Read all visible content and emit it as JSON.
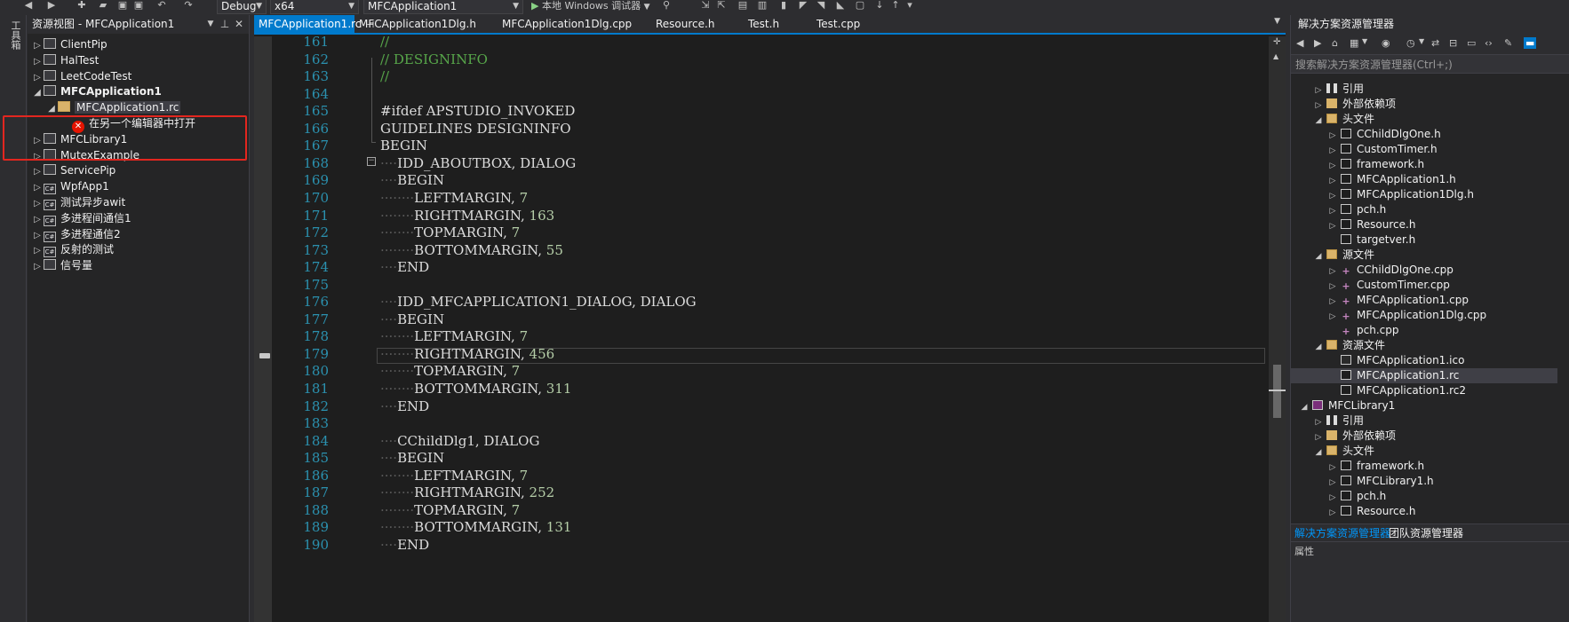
{
  "toolbar": {
    "config_combo": "Debug",
    "platform_combo": "x64",
    "startup_combo": "MFCApplication1",
    "run_label": "本地 Windows 调试器"
  },
  "left_strip": {
    "label": "工具箱"
  },
  "resource_view": {
    "title": "资源视图 - MFCApplication1",
    "items": [
      {
        "label": "ClientPip",
        "icon": "resource-icon",
        "expander": "▷"
      },
      {
        "label": "HalTest",
        "icon": "resource-icon",
        "expander": "▷"
      },
      {
        "label": "LeetCodeTest",
        "icon": "resource-icon",
        "expander": "▷"
      },
      {
        "label": "MFCApplication1",
        "icon": "resource-icon",
        "expander": "◢",
        "bold": true
      },
      {
        "label": "MFCApplication1.rc",
        "icon": "folder-icon",
        "expander": "◢",
        "indent": 1,
        "selected": true
      },
      {
        "label": "在另一个编辑器中打开",
        "icon": "error-icon",
        "indent": 2
      },
      {
        "label": "MFCLibrary1",
        "icon": "resource-icon",
        "expander": "▷"
      },
      {
        "label": "MutexExample",
        "icon": "resource-icon",
        "expander": "▷"
      },
      {
        "label": "ServicePip",
        "icon": "resource-icon",
        "expander": "▷"
      },
      {
        "label": "WpfApp1",
        "icon": "csharp-icon",
        "expander": "▷"
      },
      {
        "label": "测试异步awit",
        "icon": "csharp-icon",
        "expander": "▷"
      },
      {
        "label": "多进程间通信1",
        "icon": "csharp-icon",
        "expander": "▷"
      },
      {
        "label": "多进程通信2",
        "icon": "csharp-icon",
        "expander": "▷"
      },
      {
        "label": "反射的测试",
        "icon": "csharp-icon",
        "expander": "▷"
      },
      {
        "label": "信号量",
        "icon": "resource-icon",
        "expander": "▷"
      }
    ]
  },
  "editor": {
    "tabs": [
      {
        "label": "MFCApplication1.rc",
        "active": true
      },
      {
        "label": "MFCApplication1Dlg.h"
      },
      {
        "label": "MFCApplication1Dlg.cpp"
      },
      {
        "label": "Resource.h"
      },
      {
        "label": "Test.h"
      },
      {
        "label": "Test.cpp"
      }
    ],
    "lines": [
      {
        "n": "161",
        "code": "//",
        "type": "comment"
      },
      {
        "n": "162",
        "code": "// DESIGNINFO",
        "type": "comment"
      },
      {
        "n": "163",
        "code": "//",
        "type": "comment"
      },
      {
        "n": "164",
        "code": "",
        "type": "plain"
      },
      {
        "n": "165",
        "code": "#ifdef APSTUDIO_INVOKED",
        "type": "plain"
      },
      {
        "n": "166",
        "code": "GUIDELINES DESIGNINFO",
        "type": "plain"
      },
      {
        "n": "167",
        "code": "BEGIN",
        "type": "plain"
      },
      {
        "n": "168",
        "code": "····IDD_ABOUTBOX, DIALOG",
        "type": "plain"
      },
      {
        "n": "169",
        "code": "····BEGIN",
        "type": "plain"
      },
      {
        "n": "170",
        "code": "········LEFTMARGIN, 7",
        "type": "plain"
      },
      {
        "n": "171",
        "code": "········RIGHTMARGIN, 163",
        "type": "plain"
      },
      {
        "n": "172",
        "code": "········TOPMARGIN, 7",
        "type": "plain"
      },
      {
        "n": "173",
        "code": "········BOTTOMMARGIN, 55",
        "type": "plain"
      },
      {
        "n": "174",
        "code": "····END",
        "type": "plain"
      },
      {
        "n": "175",
        "code": "",
        "type": "plain"
      },
      {
        "n": "176",
        "code": "····IDD_MFCAPPLICATION1_DIALOG, DIALOG",
        "type": "plain"
      },
      {
        "n": "177",
        "code": "····BEGIN",
        "type": "plain"
      },
      {
        "n": "178",
        "code": "········LEFTMARGIN, 7",
        "type": "plain"
      },
      {
        "n": "179",
        "code": "········RIGHTMARGIN, 456",
        "type": "plain"
      },
      {
        "n": "180",
        "code": "········TOPMARGIN, 7",
        "type": "plain"
      },
      {
        "n": "181",
        "code": "········BOTTOMMARGIN, 311",
        "type": "plain"
      },
      {
        "n": "182",
        "code": "····END",
        "type": "plain"
      },
      {
        "n": "183",
        "code": "",
        "type": "plain"
      },
      {
        "n": "184",
        "code": "····CChildDlg1, DIALOG",
        "type": "plain"
      },
      {
        "n": "185",
        "code": "····BEGIN",
        "type": "plain"
      },
      {
        "n": "186",
        "code": "········LEFTMARGIN, 7",
        "type": "plain"
      },
      {
        "n": "187",
        "code": "········RIGHTMARGIN, 252",
        "type": "plain"
      },
      {
        "n": "188",
        "code": "········TOPMARGIN, 7",
        "type": "plain"
      },
      {
        "n": "189",
        "code": "········BOTTOMMARGIN, 131",
        "type": "plain"
      },
      {
        "n": "190",
        "code": "····END",
        "type": "plain"
      }
    ]
  },
  "solution_explorer": {
    "title": "解决方案资源管理器",
    "search_placeholder": "搜索解决方案资源管理器(Ctrl+;)",
    "items": [
      {
        "label": "引用",
        "icon": "ref",
        "expander": "▷",
        "indent": 1
      },
      {
        "label": "外部依赖项",
        "icon": "dep",
        "expander": "▷",
        "indent": 1
      },
      {
        "label": "头文件",
        "icon": "fold",
        "expander": "◢",
        "indent": 1
      },
      {
        "label": "CChildDlgOne.h",
        "icon": "hfile",
        "expander": "▷",
        "indent": 2
      },
      {
        "label": "CustomTimer.h",
        "icon": "hfile",
        "expander": "▷",
        "indent": 2
      },
      {
        "label": "framework.h",
        "icon": "hfile",
        "expander": "▷",
        "indent": 2
      },
      {
        "label": "MFCApplication1.h",
        "icon": "hfile",
        "expander": "▷",
        "indent": 2
      },
      {
        "label": "MFCApplication1Dlg.h",
        "icon": "hfile",
        "expander": "▷",
        "indent": 2
      },
      {
        "label": "pch.h",
        "icon": "hfile",
        "expander": "▷",
        "indent": 2
      },
      {
        "label": "Resource.h",
        "icon": "hfile",
        "expander": "▷",
        "indent": 2
      },
      {
        "label": "targetver.h",
        "icon": "hfile",
        "expander": "",
        "indent": 2
      },
      {
        "label": "源文件",
        "icon": "fold",
        "expander": "◢",
        "indent": 1
      },
      {
        "label": "CChildDlgOne.cpp",
        "icon": "cpp",
        "expander": "▷",
        "indent": 2
      },
      {
        "label": "CustomTimer.cpp",
        "icon": "cpp",
        "expander": "▷",
        "indent": 2
      },
      {
        "label": "MFCApplication1.cpp",
        "icon": "cpp",
        "expander": "▷",
        "indent": 2
      },
      {
        "label": "MFCApplication1Dlg.cpp",
        "icon": "cpp",
        "expander": "▷",
        "indent": 2
      },
      {
        "label": "pch.cpp",
        "icon": "cpp",
        "expander": "",
        "indent": 2
      },
      {
        "label": "资源文件",
        "icon": "fold",
        "expander": "◢",
        "indent": 1
      },
      {
        "label": "MFCApplication1.ico",
        "icon": "img",
        "expander": "",
        "indent": 2
      },
      {
        "label": "MFCApplication1.rc",
        "icon": "hfile",
        "expander": "",
        "indent": 2,
        "selected": true
      },
      {
        "label": "MFCApplication1.rc2",
        "icon": "hfile",
        "expander": "",
        "indent": 2
      },
      {
        "label": "MFCLibrary1",
        "icon": "proj",
        "expander": "◢",
        "indent": 0
      },
      {
        "label": "引用",
        "icon": "ref",
        "expander": "▷",
        "indent": 1
      },
      {
        "label": "外部依赖项",
        "icon": "dep",
        "expander": "▷",
        "indent": 1
      },
      {
        "label": "头文件",
        "icon": "fold",
        "expander": "◢",
        "indent": 1
      },
      {
        "label": "framework.h",
        "icon": "hfile",
        "expander": "▷",
        "indent": 2
      },
      {
        "label": "MFCLibrary1.h",
        "icon": "hfile",
        "expander": "▷",
        "indent": 2
      },
      {
        "label": "pch.h",
        "icon": "hfile",
        "expander": "▷",
        "indent": 2
      },
      {
        "label": "Resource.h",
        "icon": "hfile",
        "expander": "▷",
        "indent": 2
      }
    ],
    "bottom_tabs": [
      {
        "label": "解决方案资源管理器",
        "active": true
      },
      {
        "label": "团队资源管理器"
      }
    ],
    "bottom_label": "属性"
  },
  "colors": {
    "accent": "#007acc",
    "highlight_box": "#e3261f",
    "line_number": "#2b91af",
    "comment": "#57a64a",
    "number": "#b5cea8"
  }
}
